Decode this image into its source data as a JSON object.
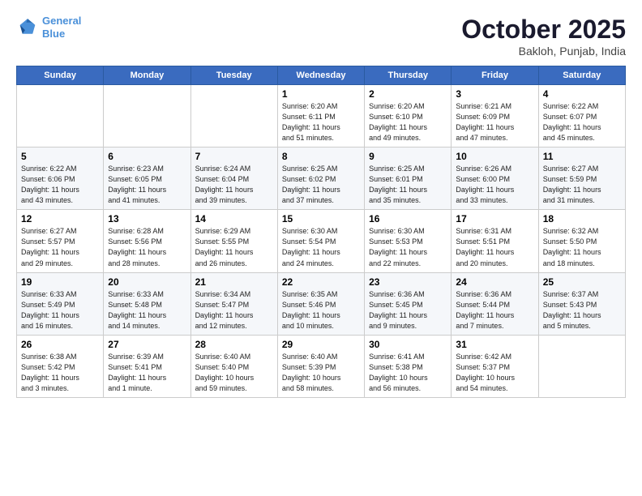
{
  "header": {
    "logo_line1": "General",
    "logo_line2": "Blue",
    "month": "October 2025",
    "location": "Bakloh, Punjab, India"
  },
  "weekdays": [
    "Sunday",
    "Monday",
    "Tuesday",
    "Wednesday",
    "Thursday",
    "Friday",
    "Saturday"
  ],
  "weeks": [
    [
      {
        "day": "",
        "info": ""
      },
      {
        "day": "",
        "info": ""
      },
      {
        "day": "",
        "info": ""
      },
      {
        "day": "1",
        "info": "Sunrise: 6:20 AM\nSunset: 6:11 PM\nDaylight: 11 hours\nand 51 minutes."
      },
      {
        "day": "2",
        "info": "Sunrise: 6:20 AM\nSunset: 6:10 PM\nDaylight: 11 hours\nand 49 minutes."
      },
      {
        "day": "3",
        "info": "Sunrise: 6:21 AM\nSunset: 6:09 PM\nDaylight: 11 hours\nand 47 minutes."
      },
      {
        "day": "4",
        "info": "Sunrise: 6:22 AM\nSunset: 6:07 PM\nDaylight: 11 hours\nand 45 minutes."
      }
    ],
    [
      {
        "day": "5",
        "info": "Sunrise: 6:22 AM\nSunset: 6:06 PM\nDaylight: 11 hours\nand 43 minutes."
      },
      {
        "day": "6",
        "info": "Sunrise: 6:23 AM\nSunset: 6:05 PM\nDaylight: 11 hours\nand 41 minutes."
      },
      {
        "day": "7",
        "info": "Sunrise: 6:24 AM\nSunset: 6:04 PM\nDaylight: 11 hours\nand 39 minutes."
      },
      {
        "day": "8",
        "info": "Sunrise: 6:25 AM\nSunset: 6:02 PM\nDaylight: 11 hours\nand 37 minutes."
      },
      {
        "day": "9",
        "info": "Sunrise: 6:25 AM\nSunset: 6:01 PM\nDaylight: 11 hours\nand 35 minutes."
      },
      {
        "day": "10",
        "info": "Sunrise: 6:26 AM\nSunset: 6:00 PM\nDaylight: 11 hours\nand 33 minutes."
      },
      {
        "day": "11",
        "info": "Sunrise: 6:27 AM\nSunset: 5:59 PM\nDaylight: 11 hours\nand 31 minutes."
      }
    ],
    [
      {
        "day": "12",
        "info": "Sunrise: 6:27 AM\nSunset: 5:57 PM\nDaylight: 11 hours\nand 29 minutes."
      },
      {
        "day": "13",
        "info": "Sunrise: 6:28 AM\nSunset: 5:56 PM\nDaylight: 11 hours\nand 28 minutes."
      },
      {
        "day": "14",
        "info": "Sunrise: 6:29 AM\nSunset: 5:55 PM\nDaylight: 11 hours\nand 26 minutes."
      },
      {
        "day": "15",
        "info": "Sunrise: 6:30 AM\nSunset: 5:54 PM\nDaylight: 11 hours\nand 24 minutes."
      },
      {
        "day": "16",
        "info": "Sunrise: 6:30 AM\nSunset: 5:53 PM\nDaylight: 11 hours\nand 22 minutes."
      },
      {
        "day": "17",
        "info": "Sunrise: 6:31 AM\nSunset: 5:51 PM\nDaylight: 11 hours\nand 20 minutes."
      },
      {
        "day": "18",
        "info": "Sunrise: 6:32 AM\nSunset: 5:50 PM\nDaylight: 11 hours\nand 18 minutes."
      }
    ],
    [
      {
        "day": "19",
        "info": "Sunrise: 6:33 AM\nSunset: 5:49 PM\nDaylight: 11 hours\nand 16 minutes."
      },
      {
        "day": "20",
        "info": "Sunrise: 6:33 AM\nSunset: 5:48 PM\nDaylight: 11 hours\nand 14 minutes."
      },
      {
        "day": "21",
        "info": "Sunrise: 6:34 AM\nSunset: 5:47 PM\nDaylight: 11 hours\nand 12 minutes."
      },
      {
        "day": "22",
        "info": "Sunrise: 6:35 AM\nSunset: 5:46 PM\nDaylight: 11 hours\nand 10 minutes."
      },
      {
        "day": "23",
        "info": "Sunrise: 6:36 AM\nSunset: 5:45 PM\nDaylight: 11 hours\nand 9 minutes."
      },
      {
        "day": "24",
        "info": "Sunrise: 6:36 AM\nSunset: 5:44 PM\nDaylight: 11 hours\nand 7 minutes."
      },
      {
        "day": "25",
        "info": "Sunrise: 6:37 AM\nSunset: 5:43 PM\nDaylight: 11 hours\nand 5 minutes."
      }
    ],
    [
      {
        "day": "26",
        "info": "Sunrise: 6:38 AM\nSunset: 5:42 PM\nDaylight: 11 hours\nand 3 minutes."
      },
      {
        "day": "27",
        "info": "Sunrise: 6:39 AM\nSunset: 5:41 PM\nDaylight: 11 hours\nand 1 minute."
      },
      {
        "day": "28",
        "info": "Sunrise: 6:40 AM\nSunset: 5:40 PM\nDaylight: 10 hours\nand 59 minutes."
      },
      {
        "day": "29",
        "info": "Sunrise: 6:40 AM\nSunset: 5:39 PM\nDaylight: 10 hours\nand 58 minutes."
      },
      {
        "day": "30",
        "info": "Sunrise: 6:41 AM\nSunset: 5:38 PM\nDaylight: 10 hours\nand 56 minutes."
      },
      {
        "day": "31",
        "info": "Sunrise: 6:42 AM\nSunset: 5:37 PM\nDaylight: 10 hours\nand 54 minutes."
      },
      {
        "day": "",
        "info": ""
      }
    ]
  ]
}
